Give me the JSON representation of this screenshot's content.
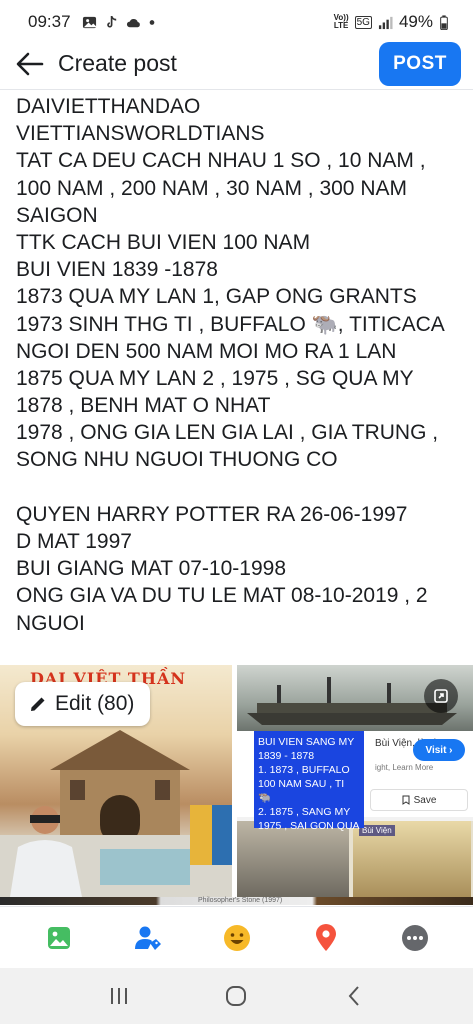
{
  "status_bar": {
    "time": "09:37",
    "network_top": "Vo))",
    "network_bottom": "LTE",
    "network_type": "5G",
    "battery": "49%",
    "icons": [
      "gallery-icon",
      "tiktok-icon",
      "cloud-icon",
      "dot-icon",
      "signal-icon",
      "battery-icon"
    ]
  },
  "header": {
    "back_icon": "back-arrow-icon",
    "title": "Create post",
    "post_label": "POST"
  },
  "post": {
    "lines": [
      "DAIVIETTHANDAO",
      "VIETTIANSWORLDTIANS",
      "TAT CA DEU CACH NHAU 1 SO , 10 NAM ,",
      "100 NAM , 200 NAM , 30 NAM , 300 NAM",
      "SAIGON",
      "TTK CACH BUI VIEN 100 NAM",
      "BUI VIEN 1839 -1878",
      "1873 QUA MY LAN 1, GAP ONG GRANTS",
      "1973 SINH THG TI , BUFFALO 🐃,  TITICACA",
      "NGOI DEN 500 NAM MOI MO RA 1 LAN",
      "1875 QUA MY LAN 2 , 1975 , SG QUA MY",
      "1878 , BENH MAT O NHAT",
      "1978 , ONG GIA LEN GIA LAI , GIA TRUNG ,",
      "SONG NHU NGUOI THUONG CO",
      "",
      "QUYEN HARRY POTTER RA 26-06-1997",
      "D MAT 1997",
      "BUI GIANG MAT 07-10-1998",
      "ONG GIA VA DU TU LE MAT 08-10-2019 , 2",
      "NGUOI"
    ]
  },
  "media": {
    "edit_label": "Edit (80)",
    "edit_icon": "pencil-icon",
    "left_banner": "DAI VIỆT THẦN ĐẠO",
    "ad_name": "Bùi Viện, là ai...",
    "ad_sub": "ight, Learn More",
    "visit_label": "Visit ›",
    "save_label": "Save",
    "blue_box": "BUI VIEN SANG MY 1839 - 1878\n1. 1873 , BUFFALO 100 NAM SAU , TI 🐃\n2. 1875 , SANG MY 1975 , SAI GON QUA",
    "photo_caption": "Bùi Viện",
    "strip_caption": "Philosopher's Stone (1997)"
  },
  "toolbar": {
    "items": [
      "photo-icon",
      "tag-people-icon",
      "feeling-icon",
      "location-icon",
      "more-icon"
    ]
  },
  "colors": {
    "accent": "#1877f2",
    "photo_green": "#45bd62",
    "tag_blue": "#1877f2",
    "feeling_yellow": "#f7b928",
    "location_red": "#f5533d",
    "more_gray": "#65676b",
    "blue_box": "#1a45e0"
  },
  "navbar": {
    "items": [
      "recent-apps-icon",
      "home-icon",
      "back-icon"
    ]
  }
}
